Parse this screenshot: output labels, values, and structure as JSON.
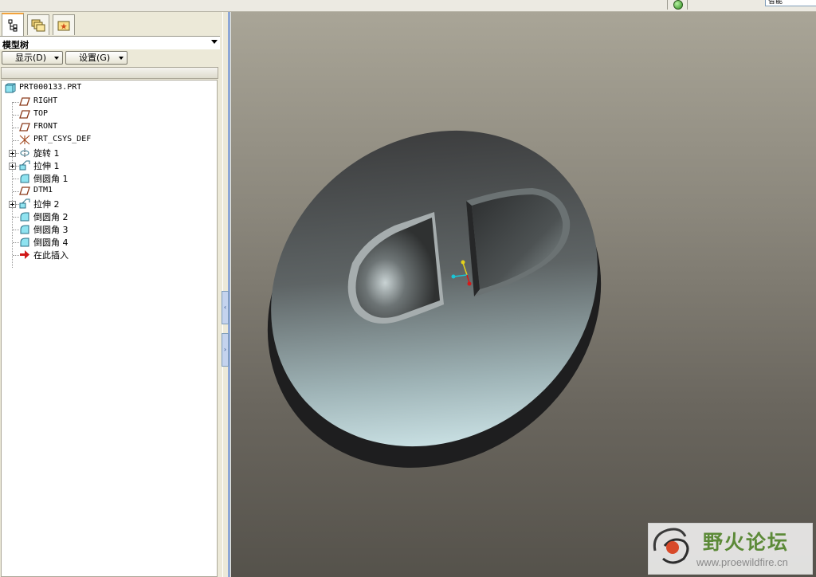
{
  "topbar": {
    "filter_value": "智能",
    "status_icon": "green-light-icon"
  },
  "left_panel": {
    "tabs": [
      {
        "name": "model-tree-tab",
        "icon": "tree-icon"
      },
      {
        "name": "folder-browser-tab",
        "icon": "folders-icon"
      },
      {
        "name": "favorites-tab",
        "icon": "star-folder-icon"
      }
    ],
    "title": "模型树",
    "buttons": {
      "display": "显示(D)",
      "settings": "设置(G)"
    }
  },
  "tree": {
    "root": {
      "label": "PRT000133.PRT",
      "icon": "part-icon"
    },
    "items": [
      {
        "label": "RIGHT",
        "icon": "datum-plane-icon",
        "expandable": false
      },
      {
        "label": "TOP",
        "icon": "datum-plane-icon",
        "expandable": false
      },
      {
        "label": "FRONT",
        "icon": "datum-plane-icon",
        "expandable": false
      },
      {
        "label": "PRT_CSYS_DEF",
        "icon": "csys-icon",
        "expandable": false
      },
      {
        "label": "旋转 1",
        "icon": "revolve-icon",
        "expandable": true
      },
      {
        "label": "拉伸 1",
        "icon": "extrude-icon",
        "expandable": true
      },
      {
        "label": "倒圆角 1",
        "icon": "round-icon",
        "expandable": false
      },
      {
        "label": "DTM1",
        "icon": "datum-plane-icon",
        "expandable": false
      },
      {
        "label": "拉伸 2",
        "icon": "extrude-icon",
        "expandable": true
      },
      {
        "label": "倒圆角 2",
        "icon": "round-icon",
        "expandable": false
      },
      {
        "label": "倒圆角 3",
        "icon": "round-icon",
        "expandable": false
      },
      {
        "label": "倒圆角 4",
        "icon": "round-icon",
        "expandable": false
      },
      {
        "label": "在此插入",
        "icon": "insert-here-arrow-icon",
        "expandable": false
      }
    ]
  },
  "watermark": {
    "title": "野火论坛",
    "url": "www.proewildfire.cn"
  }
}
